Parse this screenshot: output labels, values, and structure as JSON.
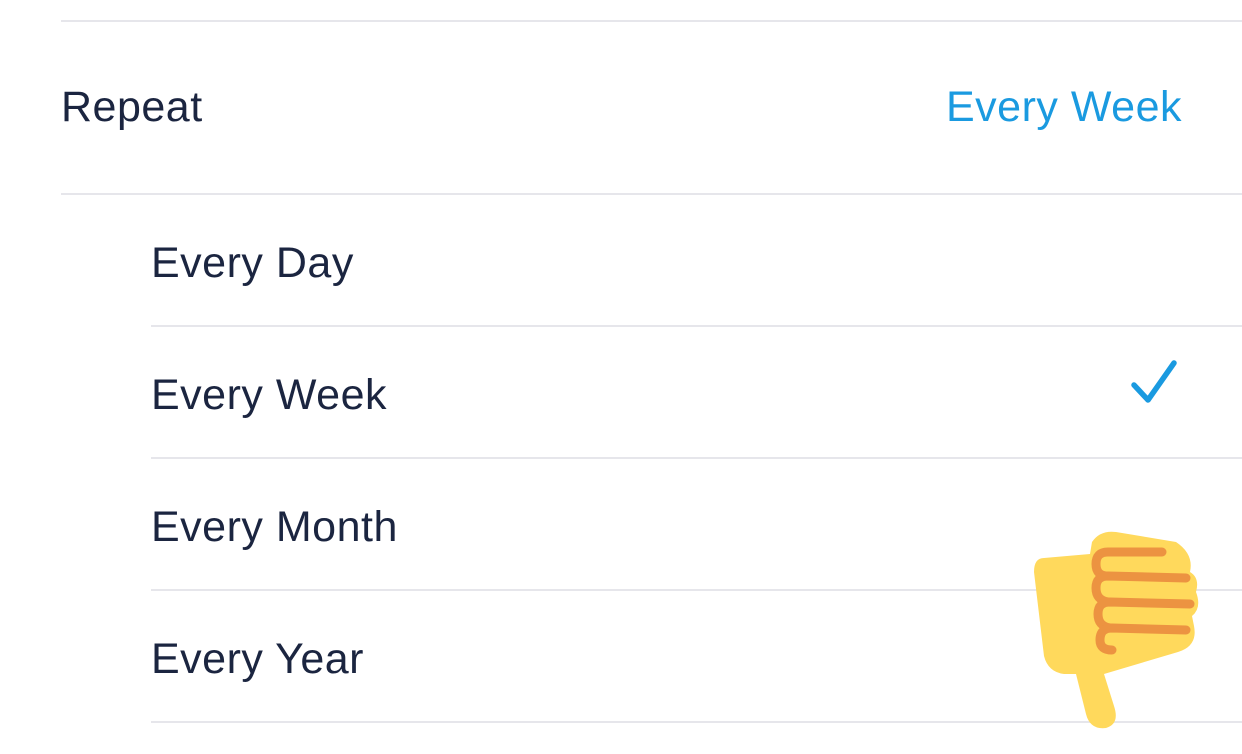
{
  "repeat": {
    "label": "Repeat",
    "value": "Every Week",
    "value_color": "#1a9ae0"
  },
  "options": [
    {
      "label": "Every Day",
      "selected": false
    },
    {
      "label": "Every Week",
      "selected": true
    },
    {
      "label": "Every Month",
      "selected": false
    },
    {
      "label": "Every Year",
      "selected": false
    }
  ],
  "icons": {
    "check": "checkmark-icon",
    "reaction": "thumbs-down-icon"
  },
  "colors": {
    "accent": "#1a9ae0",
    "text": "#1b2540",
    "divider": "#e6e6eb",
    "emoji_yellow": "#ffd95c",
    "emoji_orange": "#ec9341"
  }
}
